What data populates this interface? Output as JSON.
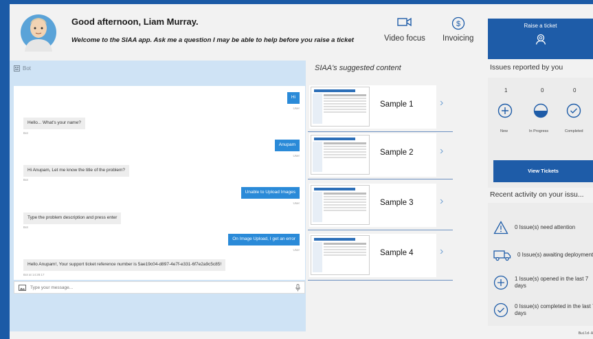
{
  "header": {
    "greeting": "Good afternoon, Liam Murray.",
    "welcome": "Welcome to the SIAA app. Ask me a question I may be able to help before you raise a ticket",
    "video_label": "Video focus",
    "invoicing_label": "Invoicing"
  },
  "bot": {
    "title": "Bot",
    "messages": [
      {
        "from": "user",
        "text": "Hi",
        "caption": "User"
      },
      {
        "from": "bot",
        "text": "Hello... What's your name?",
        "caption": "Bot"
      },
      {
        "from": "user",
        "text": "Anupam",
        "caption": "User"
      },
      {
        "from": "bot",
        "text": "Hi Anupam, Let me know the title of the problem?",
        "caption": "Bot"
      },
      {
        "from": "user",
        "text": "Unable to Upload Images",
        "caption": "User"
      },
      {
        "from": "bot",
        "text": "Type the problem description and press enter",
        "caption": "Bot"
      },
      {
        "from": "user",
        "text": "On Image Upload, I get an error",
        "caption": "User"
      },
      {
        "from": "bot",
        "text": "Hello Anupam!, Your support ticket reference number is 5ae19c04-d897-4e7f-e331-6f7e2a9c5c85!",
        "caption": "Bot at 14:28:17"
      }
    ],
    "input_placeholder": "Type your message..."
  },
  "suggested": {
    "title": "SIAA's suggested content",
    "items": [
      {
        "label": "Sample 1"
      },
      {
        "label": "Sample 2"
      },
      {
        "label": "Sample 3"
      },
      {
        "label": "Sample 4"
      }
    ]
  },
  "raise_ticket": {
    "label": "Raise a ticket",
    "icon": "person-search-icon"
  },
  "issues": {
    "title": "Issues reported by you",
    "stats": [
      {
        "count": "1",
        "label": "New",
        "icon": "plus-circle-icon"
      },
      {
        "count": "0",
        "label": "In Progress",
        "icon": "half-circle-icon"
      },
      {
        "count": "0",
        "label": "Completed",
        "icon": "check-circle-icon"
      }
    ],
    "view_tickets": "View Tickets"
  },
  "activity": {
    "title": "Recent activity on your issu...",
    "items": [
      {
        "text": "0 Issue(s) need attention",
        "icon": "warning-triangle-icon"
      },
      {
        "text": "0 Issue(s) awaiting deployment",
        "icon": "truck-icon"
      },
      {
        "text": "1 Issue(s) opened in the last 7 days",
        "icon": "plus-circle-icon"
      },
      {
        "text": "0 Issue(s) completed in the last 7 days",
        "icon": "check-circle-icon"
      }
    ]
  },
  "build_label": "Build-A",
  "colors": {
    "accent": "#1e5ca8",
    "frame": "#1b5aa6",
    "user_bubble": "#2a8ad8",
    "bot_panel": "#cfe3f5"
  }
}
